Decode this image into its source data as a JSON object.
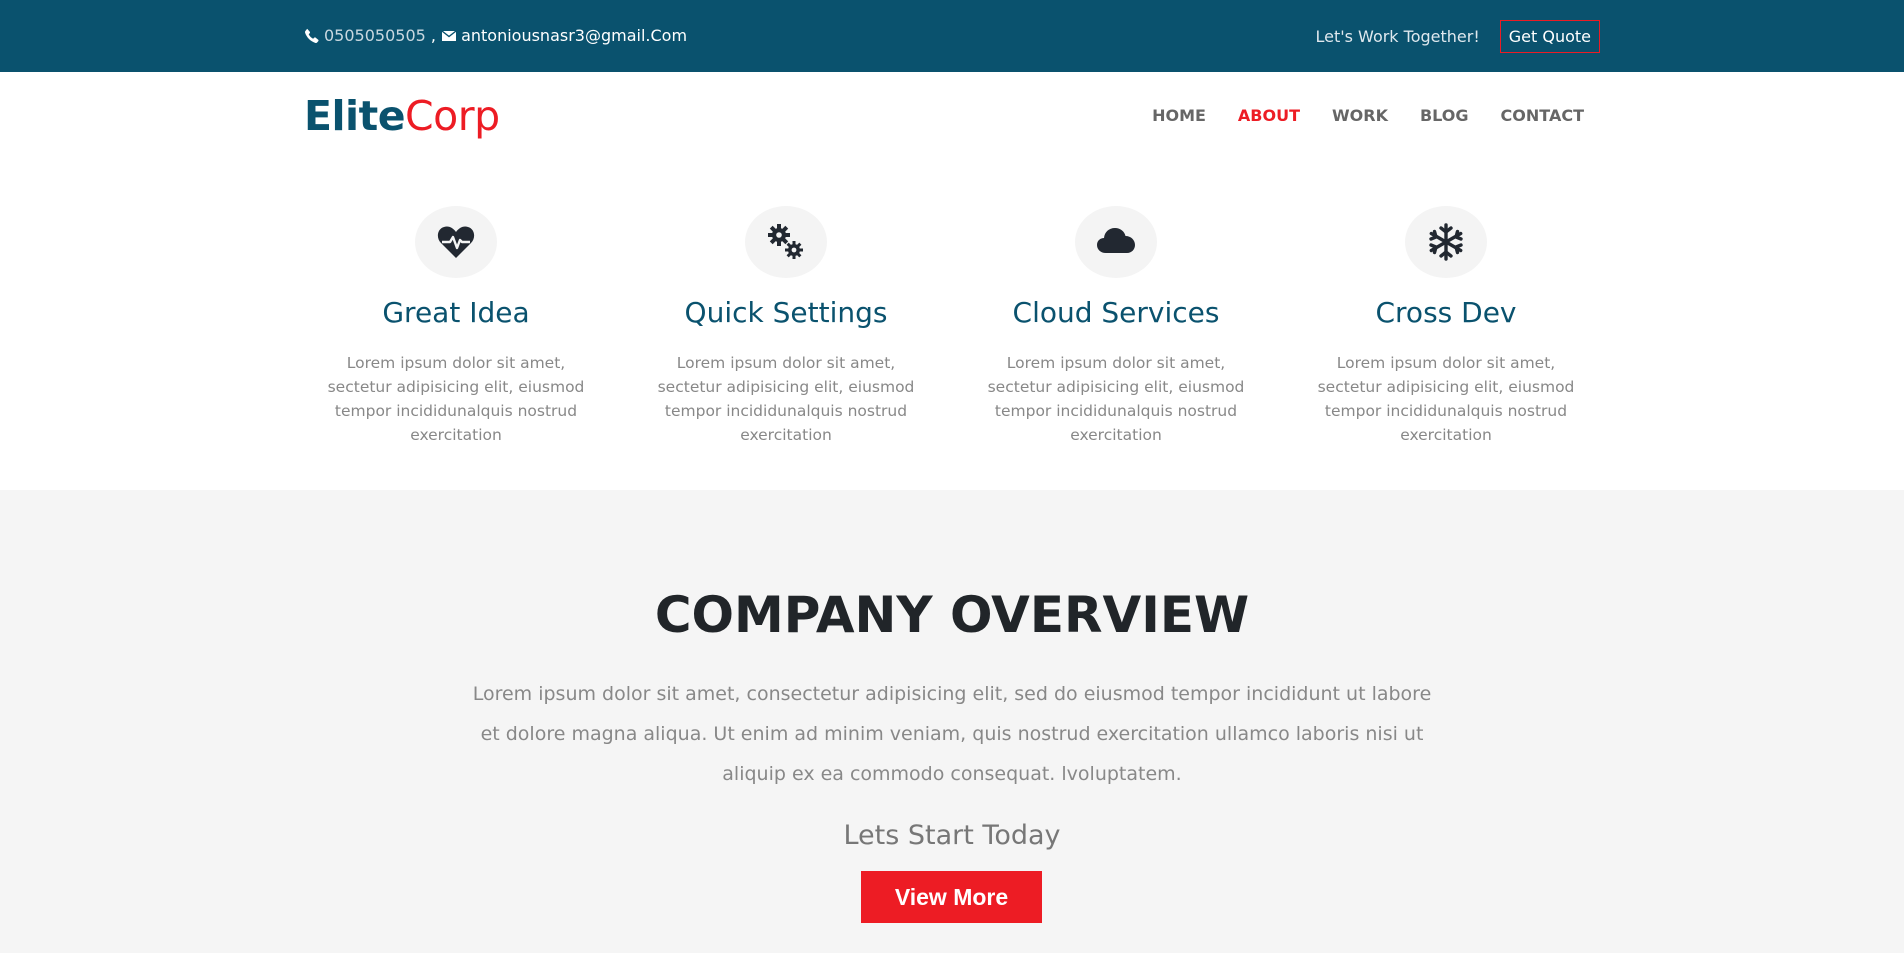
{
  "topbar": {
    "phone": "0505050505",
    "separator": " , ",
    "email": "antoniousnasr3@gmail.Com",
    "tagline": "Let's Work Together!",
    "quote_label": "Get Quote"
  },
  "brand": {
    "part1": "Elite",
    "part2": "Corp"
  },
  "nav": {
    "items": [
      {
        "label": "HOME"
      },
      {
        "label": "ABOUT"
      },
      {
        "label": "WORK"
      },
      {
        "label": "BLOG"
      },
      {
        "label": "CONTACT"
      }
    ],
    "active": "ABOUT"
  },
  "features": [
    {
      "icon": "heartbeat-icon",
      "title": "Great Idea",
      "text": "Lorem ipsum dolor sit amet, sectetur adipisicing elit, eiusmod tempor incididunalquis nostrud exercitation"
    },
    {
      "icon": "cogs-icon",
      "title": "Quick Settings",
      "text": "Lorem ipsum dolor sit amet, sectetur adipisicing elit, eiusmod tempor incididunalquis nostrud exercitation"
    },
    {
      "icon": "cloud-icon",
      "title": "Cloud Services",
      "text": "Lorem ipsum dolor sit amet, sectetur adipisicing elit, eiusmod tempor incididunalquis nostrud exercitation"
    },
    {
      "icon": "snowflake-icon",
      "title": "Cross Dev",
      "text": "Lorem ipsum dolor sit amet, sectetur adipisicing elit, eiusmod tempor incididunalquis nostrud exercitation"
    }
  ],
  "overview": {
    "title": "COMPANY OVERVIEW",
    "description": "Lorem ipsum dolor sit amet, consectetur adipisicing elit, sed do eiusmod tempor incididunt ut labore et dolore magna aliqua. Ut enim ad minim veniam, quis nostrud exercitation ullamco laboris nisi ut aliquip ex ea commodo consequat. lvoluptatem.",
    "subtitle": "Lets Start Today",
    "button_label": "View More"
  },
  "colors": {
    "primary": "#0a526e",
    "accent": "#ed1c24",
    "muted_text": "#888888",
    "section_bg": "#f5f5f5"
  }
}
